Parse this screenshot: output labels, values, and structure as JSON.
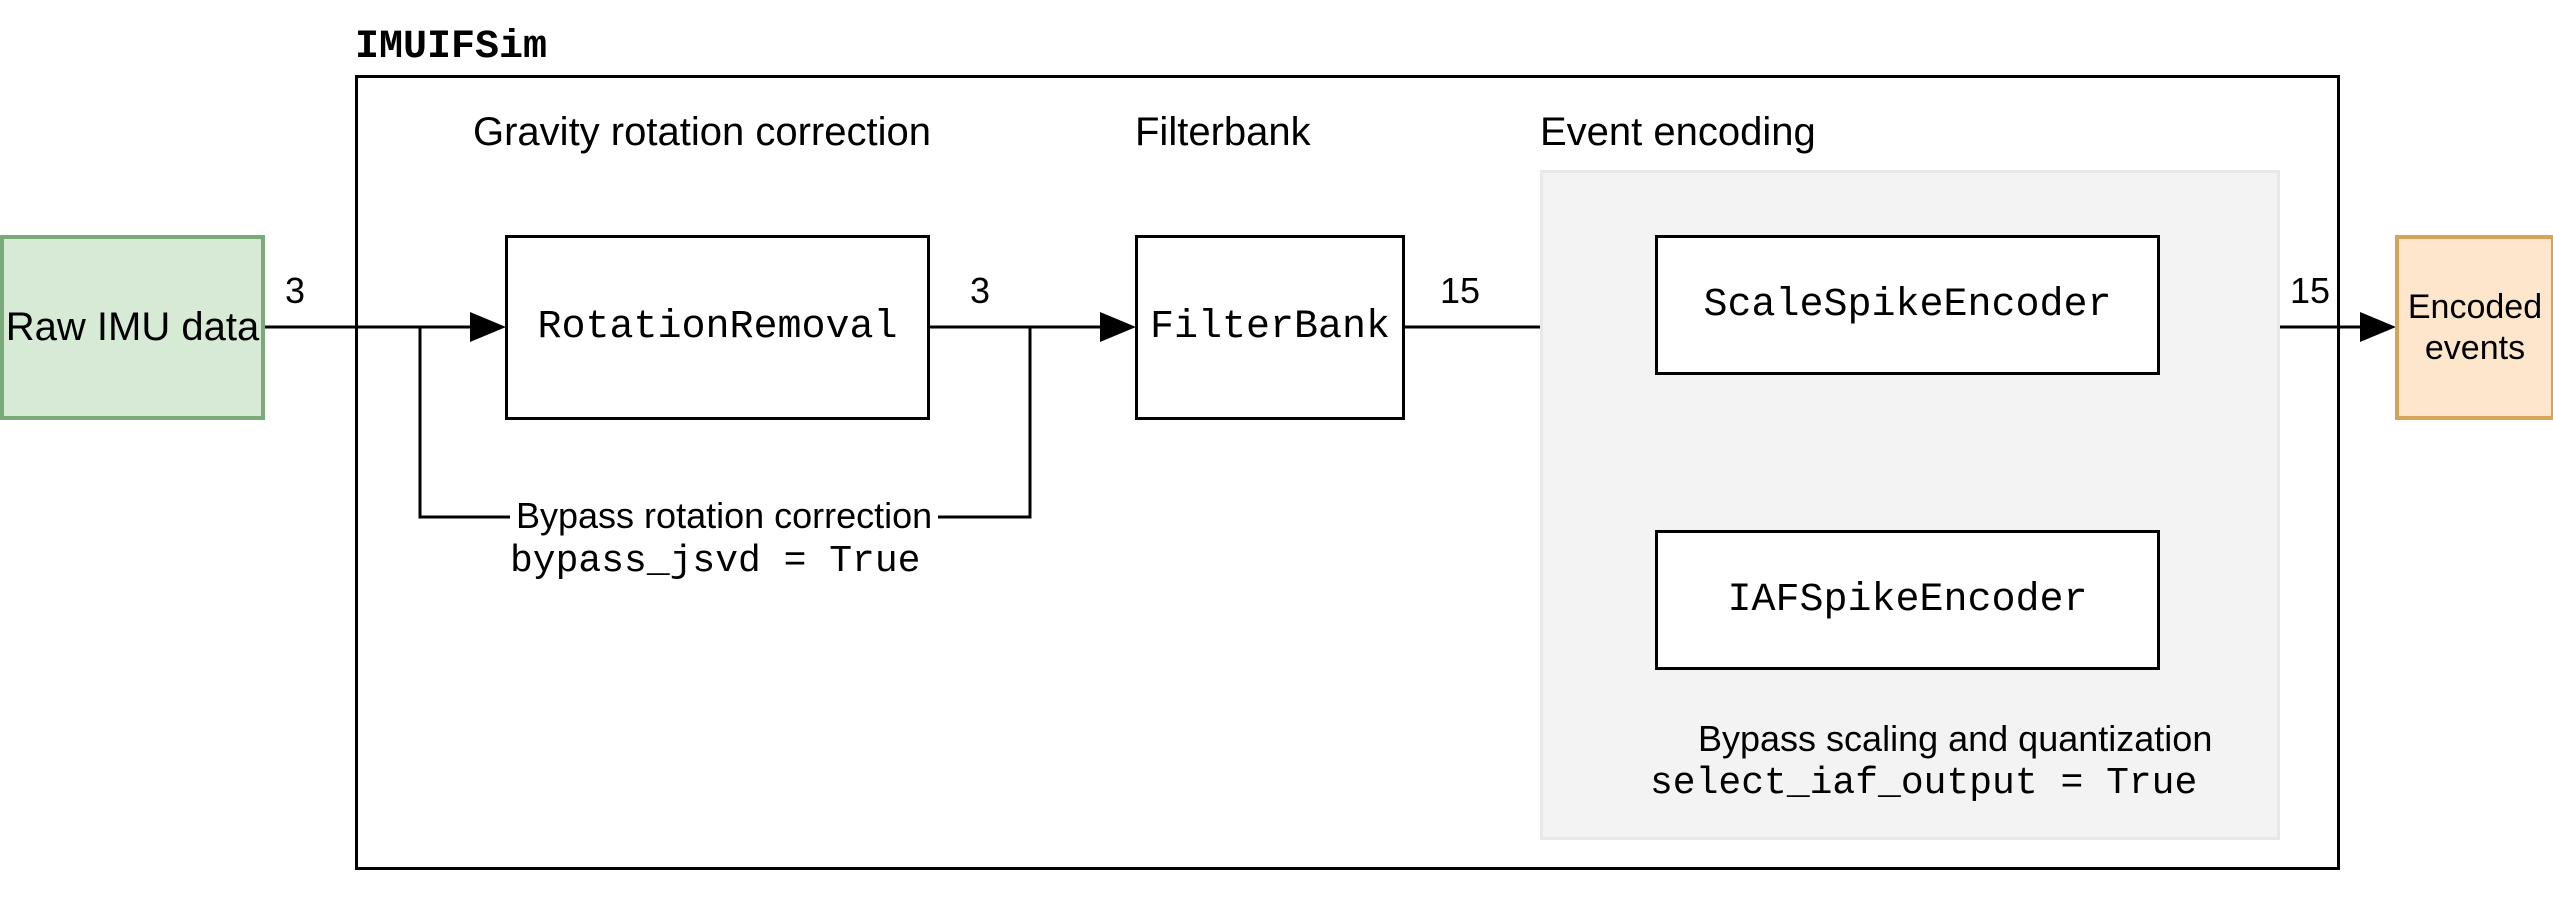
{
  "diagram": {
    "title": "IMUIFSim",
    "input": "Raw IMU data",
    "output_line1": "Encoded",
    "output_line2": "events",
    "sections": {
      "gravity": "Gravity rotation correction",
      "filterbank": "Filterbank",
      "event_encoding": "Event encoding"
    },
    "blocks": {
      "rotation_removal": "RotationRemoval",
      "filter_bank": "FilterBank",
      "scale_spike_encoder": "ScaleSpikeEncoder",
      "iaf_spike_encoder": "IAFSpikeEncoder"
    },
    "bypass_rotation": {
      "label": "Bypass rotation correction",
      "code": "bypass_jsvd = True"
    },
    "bypass_scaling": {
      "label": "Bypass scaling and quantization",
      "code": "select_iaf_output = True"
    },
    "edge_labels": {
      "input_to_rotation": "3",
      "rotation_to_filter": "3",
      "filter_to_encoder": "15",
      "encoder_to_output": "15"
    }
  }
}
